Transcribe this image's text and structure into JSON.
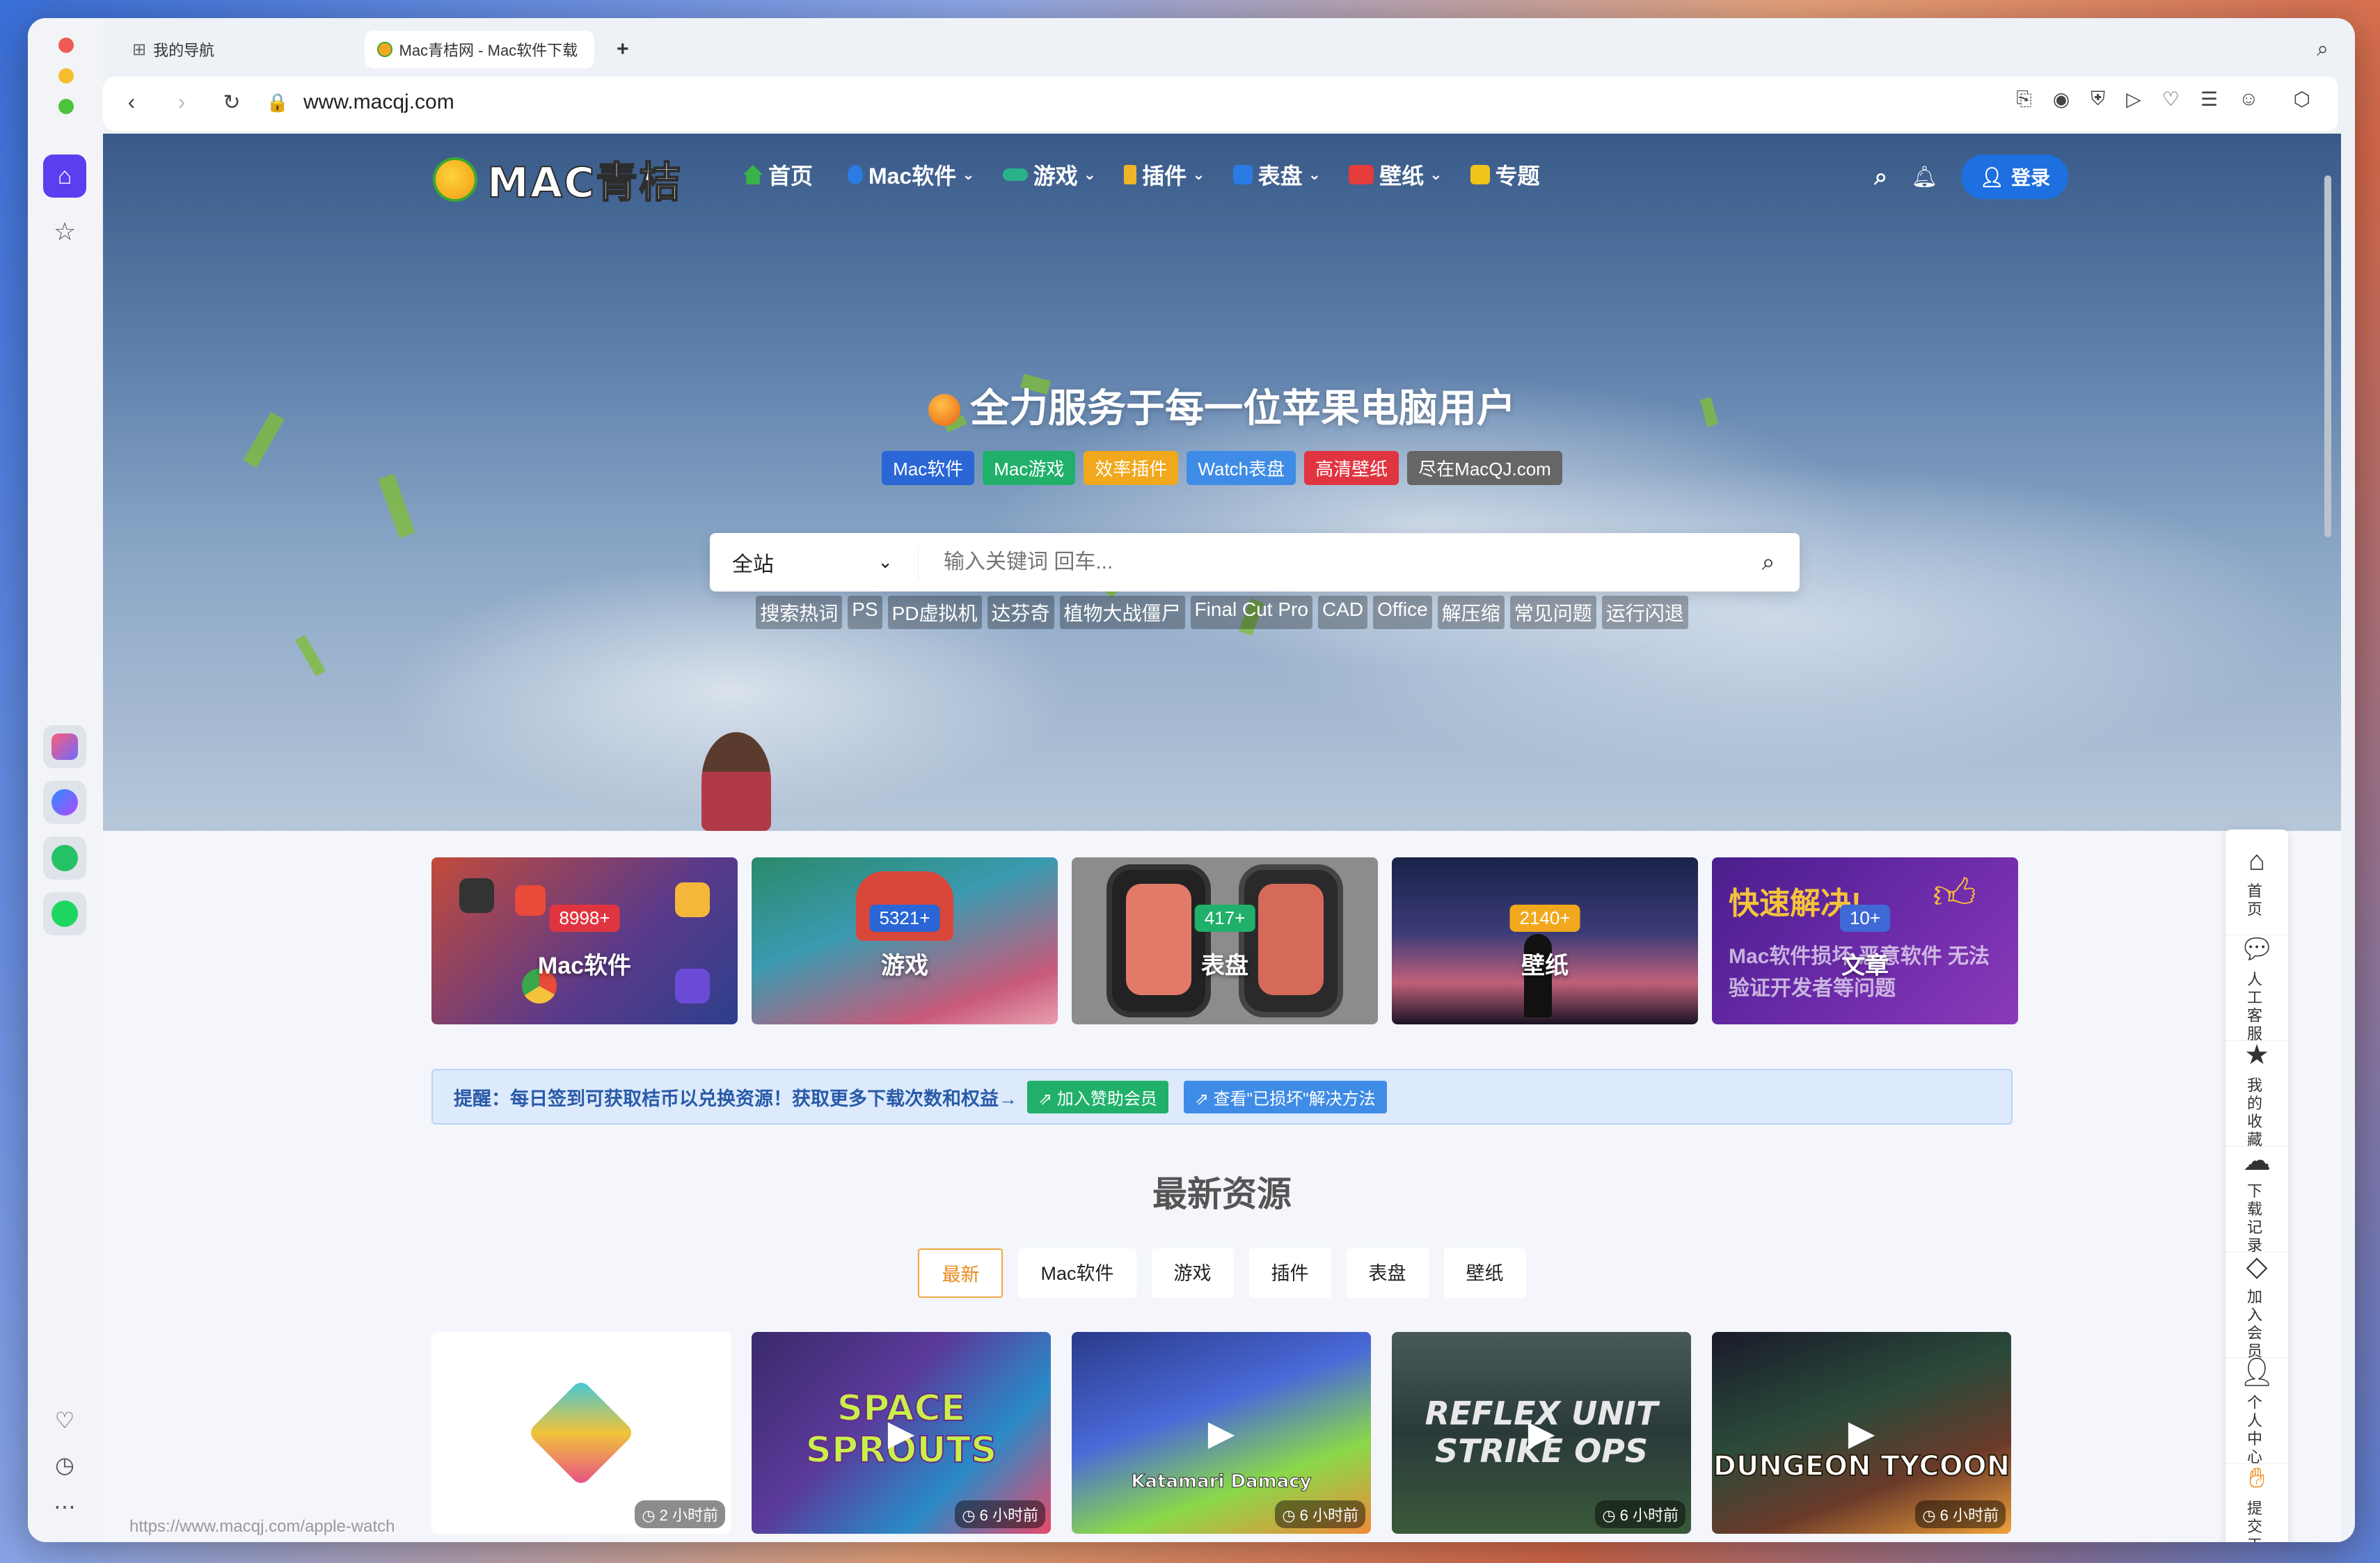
{
  "browser": {
    "tabs": [
      {
        "label": "我的导航"
      },
      {
        "label": "Mac青桔网 - Mac软件下载"
      }
    ],
    "url": "www.macqj.com",
    "status_url": "https://www.macqj.com/apple-watch"
  },
  "site": {
    "logo_text": "MAC青桔",
    "nav": [
      {
        "label": "首页",
        "icon": "home-icon",
        "color": "#37b34a"
      },
      {
        "label": "Mac软件",
        "icon": "apple-icon",
        "color": "#2a7be4"
      },
      {
        "label": "游戏",
        "icon": "gamepad-icon",
        "color": "#2ab38a"
      },
      {
        "label": "插件",
        "icon": "plug-icon",
        "color": "#f0b429"
      },
      {
        "label": "表盘",
        "icon": "watch-icon",
        "color": "#2a7be4"
      },
      {
        "label": "壁纸",
        "icon": "wallpaper-icon",
        "color": "#e43b3b"
      },
      {
        "label": "专题",
        "icon": "grid-icon",
        "color": "#f0c419"
      }
    ],
    "login_label": "登录"
  },
  "hero": {
    "title": "全力服务于每一位苹果电脑用户",
    "tags": [
      {
        "label": "Mac软件",
        "color": "#2a66d6"
      },
      {
        "label": "Mac游戏",
        "color": "#20b06a"
      },
      {
        "label": "效率插件",
        "color": "#f2a81d"
      },
      {
        "label": "Watch表盘",
        "color": "#3f8ce6"
      },
      {
        "label": "高清壁纸",
        "color": "#e03540"
      },
      {
        "label": "尽在MacQJ.com",
        "color": "#666666"
      }
    ],
    "search_scope": "全站",
    "search_placeholder": "输入关键词 回车...",
    "hotwords": [
      "搜索热词",
      "PS",
      "PD虚拟机",
      "达芬奇",
      "植物大战僵尸",
      "Final Cut Pro",
      "CAD",
      "Office",
      "解压缩",
      "常见问题",
      "运行闪退"
    ]
  },
  "categories": [
    {
      "count": "8998+",
      "name": "Mac软件",
      "badge_color": "#e03540"
    },
    {
      "count": "5321+",
      "name": "游戏",
      "badge_color": "#2a66d6"
    },
    {
      "count": "417+",
      "name": "表盘",
      "badge_color": "#20b06a"
    },
    {
      "count": "2140+",
      "name": "壁纸",
      "badge_color": "#f2a81d"
    },
    {
      "count": "10+",
      "name": "文章",
      "badge_color": "#3f6ad6",
      "overlay_title": "快速解决!",
      "overlay_sub": "Mac软件损坏 恶意软件 无法验证开发者等问题"
    }
  ],
  "notice": {
    "text": "提醒：每日签到可获取桔币以兑换资源！获取更多下载次数和权益→",
    "btn1": "加入赞助会员",
    "btn2": "查看\"已损坏\"解决方法"
  },
  "latest": {
    "title": "最新资源",
    "filters": [
      "最新",
      "Mac软件",
      "游戏",
      "插件",
      "表盘",
      "壁纸"
    ],
    "posts": [
      {
        "time": "2 小时前",
        "title": ""
      },
      {
        "time": "6 小时前",
        "title": "SPACE SPROUTS"
      },
      {
        "time": "6 小时前",
        "title": "Katamari Damacy"
      },
      {
        "time": "6 小时前",
        "title": "REFLEX UNIT STRIKE OPS"
      },
      {
        "time": "6 小时前",
        "title": "DUNGEON TYCOON"
      }
    ]
  },
  "right_panel": [
    {
      "label": "首页",
      "icon": "home-icon"
    },
    {
      "label": "人工客服",
      "icon": "chat-icon"
    },
    {
      "label": "我的收藏",
      "icon": "star-icon"
    },
    {
      "label": "下载记录",
      "icon": "cloud-download-icon"
    },
    {
      "label": "加入会员",
      "icon": "diamond-icon"
    },
    {
      "label": "个人中心",
      "icon": "user-icon"
    },
    {
      "label": "提交工单",
      "icon": "hand-icon"
    }
  ]
}
